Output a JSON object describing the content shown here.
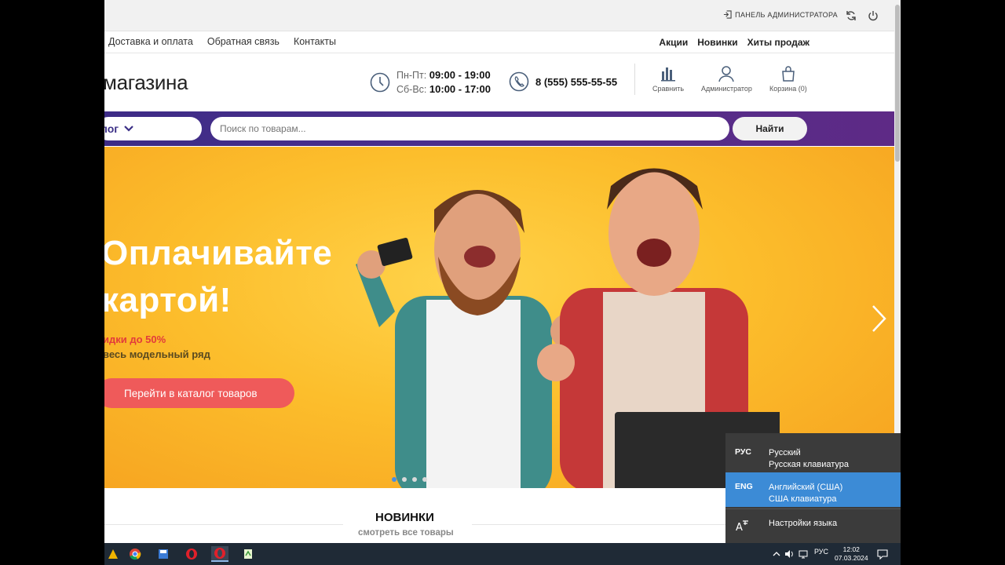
{
  "admin_bar": {
    "panel_label": "ПАНЕЛЬ АДМИНИСТРАТОРА"
  },
  "top_nav": {
    "left": [
      "Доставка и оплата",
      "Обратная связь",
      "Контакты"
    ],
    "right": [
      "Акции",
      "Новинки",
      "Хиты продаж"
    ]
  },
  "header": {
    "logo_text": "магазина",
    "hours_weekdays_label": "Пн-Пт:",
    "hours_weekdays": "09:00 - 19:00",
    "hours_weekend_label": "Сб-Вс:",
    "hours_weekend": "10:00 - 17:00",
    "phone": "8 (555) 555-55-55",
    "compare_label": "Сравнить",
    "admin_label": "Администратор",
    "cart_label": "Корзина (0)"
  },
  "search": {
    "catalog_label": "лог",
    "placeholder": "Поиск по товарам...",
    "button_label": "Найти"
  },
  "banner": {
    "title_line1": "Оплачивайте",
    "title_line2": "картой!",
    "sub1": "идки до 50%",
    "sub2": "весь модельный ряд",
    "cta": "Перейти в каталог товаров",
    "active_slide": 1,
    "slide_count": 4
  },
  "section": {
    "title": "НОВИНКИ",
    "link": "смотреть все товары"
  },
  "language_popup": {
    "items": [
      {
        "code": "РУС",
        "name": "Русский",
        "keyboard": "Русская клавиатура"
      },
      {
        "code": "ENG",
        "name": "Английский (США)",
        "keyboard": "США клавиатура"
      }
    ],
    "settings_label": "Настройки языка"
  },
  "taskbar": {
    "lang_indicator": "РУС",
    "time": "12:02",
    "date": "07.03.2024"
  },
  "colors": {
    "accent_purple": "#4b2f8c",
    "cta_red": "#ef5a5a",
    "banner_yellow": "#fcbe2c",
    "lang_active": "#3c8bd6"
  }
}
